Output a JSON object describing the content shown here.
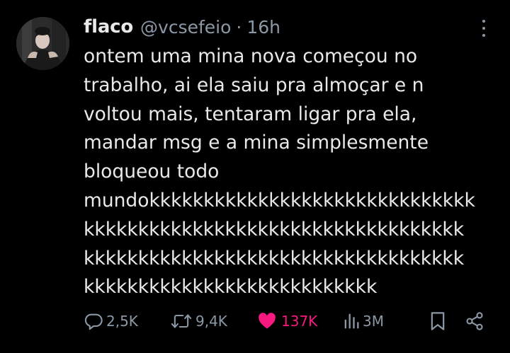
{
  "tweet": {
    "display_name": "flaco",
    "handle": "@vcsefeio",
    "separator": "·",
    "time": "16h",
    "text_lines": [
      "ontem uma mina nova começou no",
      "trabalho, ai ela saiu pra almoçar e n",
      "voltou mais, tentaram ligar pra ela,",
      "mandar msg e a mina simplesmente",
      "bloqueou todo",
      "mundokkkkkkkkkkkkkkkkkkkkkkkkkkkkkk",
      "kkkkkkkkkkkkkkkkkkkkkkkkkkkkkkkkkkk",
      "kkkkkkkkkkkkkkkkkkkkkkkkkkkkkkkkkkk",
      "kkkkkkkkkkkkkkkkkkkkkkkkkkk"
    ]
  },
  "actions": {
    "replies": "2,5K",
    "retweets": "9,4K",
    "likes": "137K",
    "views": "3M"
  },
  "icons": [
    "avatar",
    "more-icon",
    "reply-icon",
    "retweet-icon",
    "heart-icon",
    "views-icon",
    "bookmark-icon",
    "share-icon"
  ],
  "colors": {
    "background": "#000000",
    "text": "#e7e9ea",
    "secondary": "#8b98a5",
    "like": "#f91880"
  }
}
